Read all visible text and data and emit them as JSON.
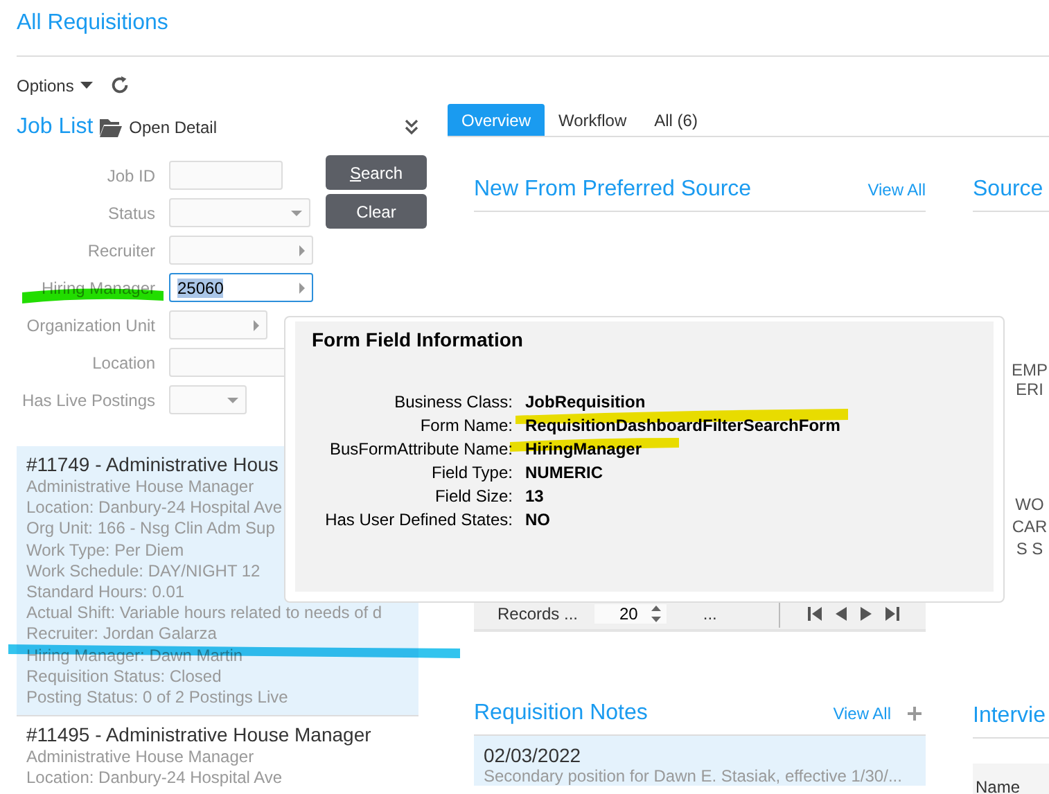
{
  "page": {
    "title": "All Requisitions",
    "options_label": "Options"
  },
  "job_list": {
    "title": "Job List",
    "open_detail": "Open Detail"
  },
  "filters": [
    {
      "label": "Job ID",
      "kind": "text",
      "focused": false
    },
    {
      "label": "Status",
      "kind": "dropdown",
      "focused": false
    },
    {
      "label": "Recruiter",
      "kind": "lookup",
      "focused": false
    },
    {
      "label": "Hiring Manager",
      "kind": "lookup",
      "value": "25060",
      "focused": true
    },
    {
      "label": "Organization Unit",
      "kind": "lookup",
      "focused": false
    },
    {
      "label": "Location",
      "kind": "text",
      "focused": false
    },
    {
      "label": "Has Live Postings",
      "kind": "dropdown",
      "focused": false
    }
  ],
  "filter_buttons": [
    "Search",
    "Clear"
  ],
  "requisitions": [
    {
      "title": "#11749 - Administrative Hous",
      "selected": true,
      "lines": [
        "Administrative House Manager",
        "Location: Danbury-24 Hospital Ave",
        "Org Unit: 166 - Nsg Clin Adm Sup",
        "Work Type: Per Diem",
        "Work Schedule: DAY/NIGHT 12",
        "Standard Hours: 0.01",
        "Actual Shift: Variable hours related to needs of d",
        "Recruiter: Jordan Galarza",
        "Hiring Manager: Dawn Martin",
        "Requisition Status: Closed",
        "Posting Status: 0 of 2 Postings Live"
      ]
    },
    {
      "title": "#11495 - Administrative House Manager",
      "selected": false,
      "lines": [
        "Administrative House Manager",
        "Location: Danbury-24 Hospital Ave"
      ]
    }
  ],
  "tabs": [
    {
      "label": "Overview",
      "selected": true
    },
    {
      "label": "Workflow",
      "selected": false
    },
    {
      "label": "All (6)",
      "selected": false
    }
  ],
  "preferred_source": {
    "title": "New From Preferred Source",
    "link": "View All"
  },
  "records_bar": {
    "label": "Records ...",
    "page_size": "20",
    "ellipsis": "..."
  },
  "notes": {
    "title": "Requisition Notes",
    "link": "View All",
    "items": [
      {
        "date": "02/03/2022",
        "text": "Secondary position for Dawn E. Stasiak, effective 1/30/..."
      }
    ]
  },
  "side_column": {
    "title": "Source",
    "texts": [
      [
        "EMP",
        "ERI"
      ],
      [
        "WO",
        "CAR",
        "S S"
      ]
    ],
    "second_title": "Intervie",
    "column_header": "Name"
  },
  "popup": {
    "title": "Form Field Information",
    "rows": [
      {
        "label": "Business Class:",
        "value": "JobRequisition"
      },
      {
        "label": "Form Name:",
        "value": "RequisitionDashboardFilterSearchForm"
      },
      {
        "label": "BusFormAttribute Name:",
        "value": "HiringManager"
      },
      {
        "label": "Field Type:",
        "value": "NUMERIC"
      },
      {
        "label": "Field Size:",
        "value": "13"
      },
      {
        "label": "Has User Defined States:",
        "value": "NO"
      }
    ]
  }
}
